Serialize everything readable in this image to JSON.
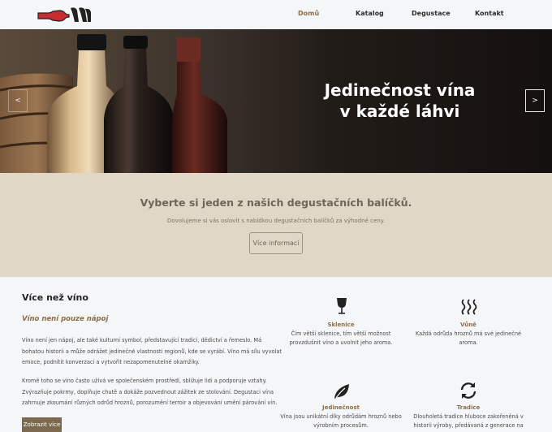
{
  "nav": {
    "items": [
      {
        "label": "Domů",
        "active": true
      },
      {
        "label": "Katalog",
        "active": false
      },
      {
        "label": "Degustace",
        "active": false
      },
      {
        "label": "Kontakt",
        "active": false
      }
    ],
    "logo_icon": "wine-bottle-logo"
  },
  "hero": {
    "title_line1": "Jedinečnost vína",
    "title_line2": "v každé láhvi",
    "prev_label": "<",
    "next_label": ">"
  },
  "promo": {
    "title": "Vyberte si jeden z našich degustačních balíčků.",
    "text": "Dovolujeme si vás oslovit s nabídkou degustačních balíčků za výhodné ceny.",
    "button": "Více informací"
  },
  "about": {
    "title": "Více než víno",
    "subtitle": "Víno není pouze nápoj",
    "paragraph1": "Víno není jen nápoj, ale také kulturní symbol, představující tradici, dědictví a řemeslo. Má bohatou historii a může odrážet jedinečné vlastnosti regionů, kde se vyrábí. Víno má sílu vyvolat emoce, podnítit konverzaci a vytvořit nezapomenutelné okamžiky.",
    "paragraph2": "Kromě toho se víno často užívá ve společenském prostředí, sbližuje lidi a podporuje vztahy. Zvýrazňuje pokrmy, doplňuje chutě a dokáže pozvednout zážitek ze stolování. Degustaci vína zahrnuje zkoumání různých odrůd hroznů, porozumění terroir a objevování umění párování vín.",
    "button": "Zobrazit více"
  },
  "features": [
    {
      "icon": "wine-glass-icon",
      "title": "Sklenice",
      "text": "Čím větší sklenice, tím větší možnost provzdušnit víno a uvolnit jeho aroma."
    },
    {
      "icon": "aroma-icon",
      "title": "Vůně",
      "text": "Každá odrůda hroznů má své jedinečné aroma."
    },
    {
      "icon": "leaf-icon",
      "title": "Jedinečnost",
      "text": "Vína jsou unikátní díky odrůdám hroznů nebo výrobním procesům."
    },
    {
      "icon": "refresh-icon",
      "title": "Tradice",
      "text": "Dlouholetá tradice hluboce zakořeněná v historii výroby, předávaná z generace na"
    }
  ],
  "colors": {
    "accent": "#8a6e47",
    "promo_bg": "#e0d7c6",
    "button_bg": "#7d6a4e",
    "page_bg": "#f5f6f8"
  }
}
